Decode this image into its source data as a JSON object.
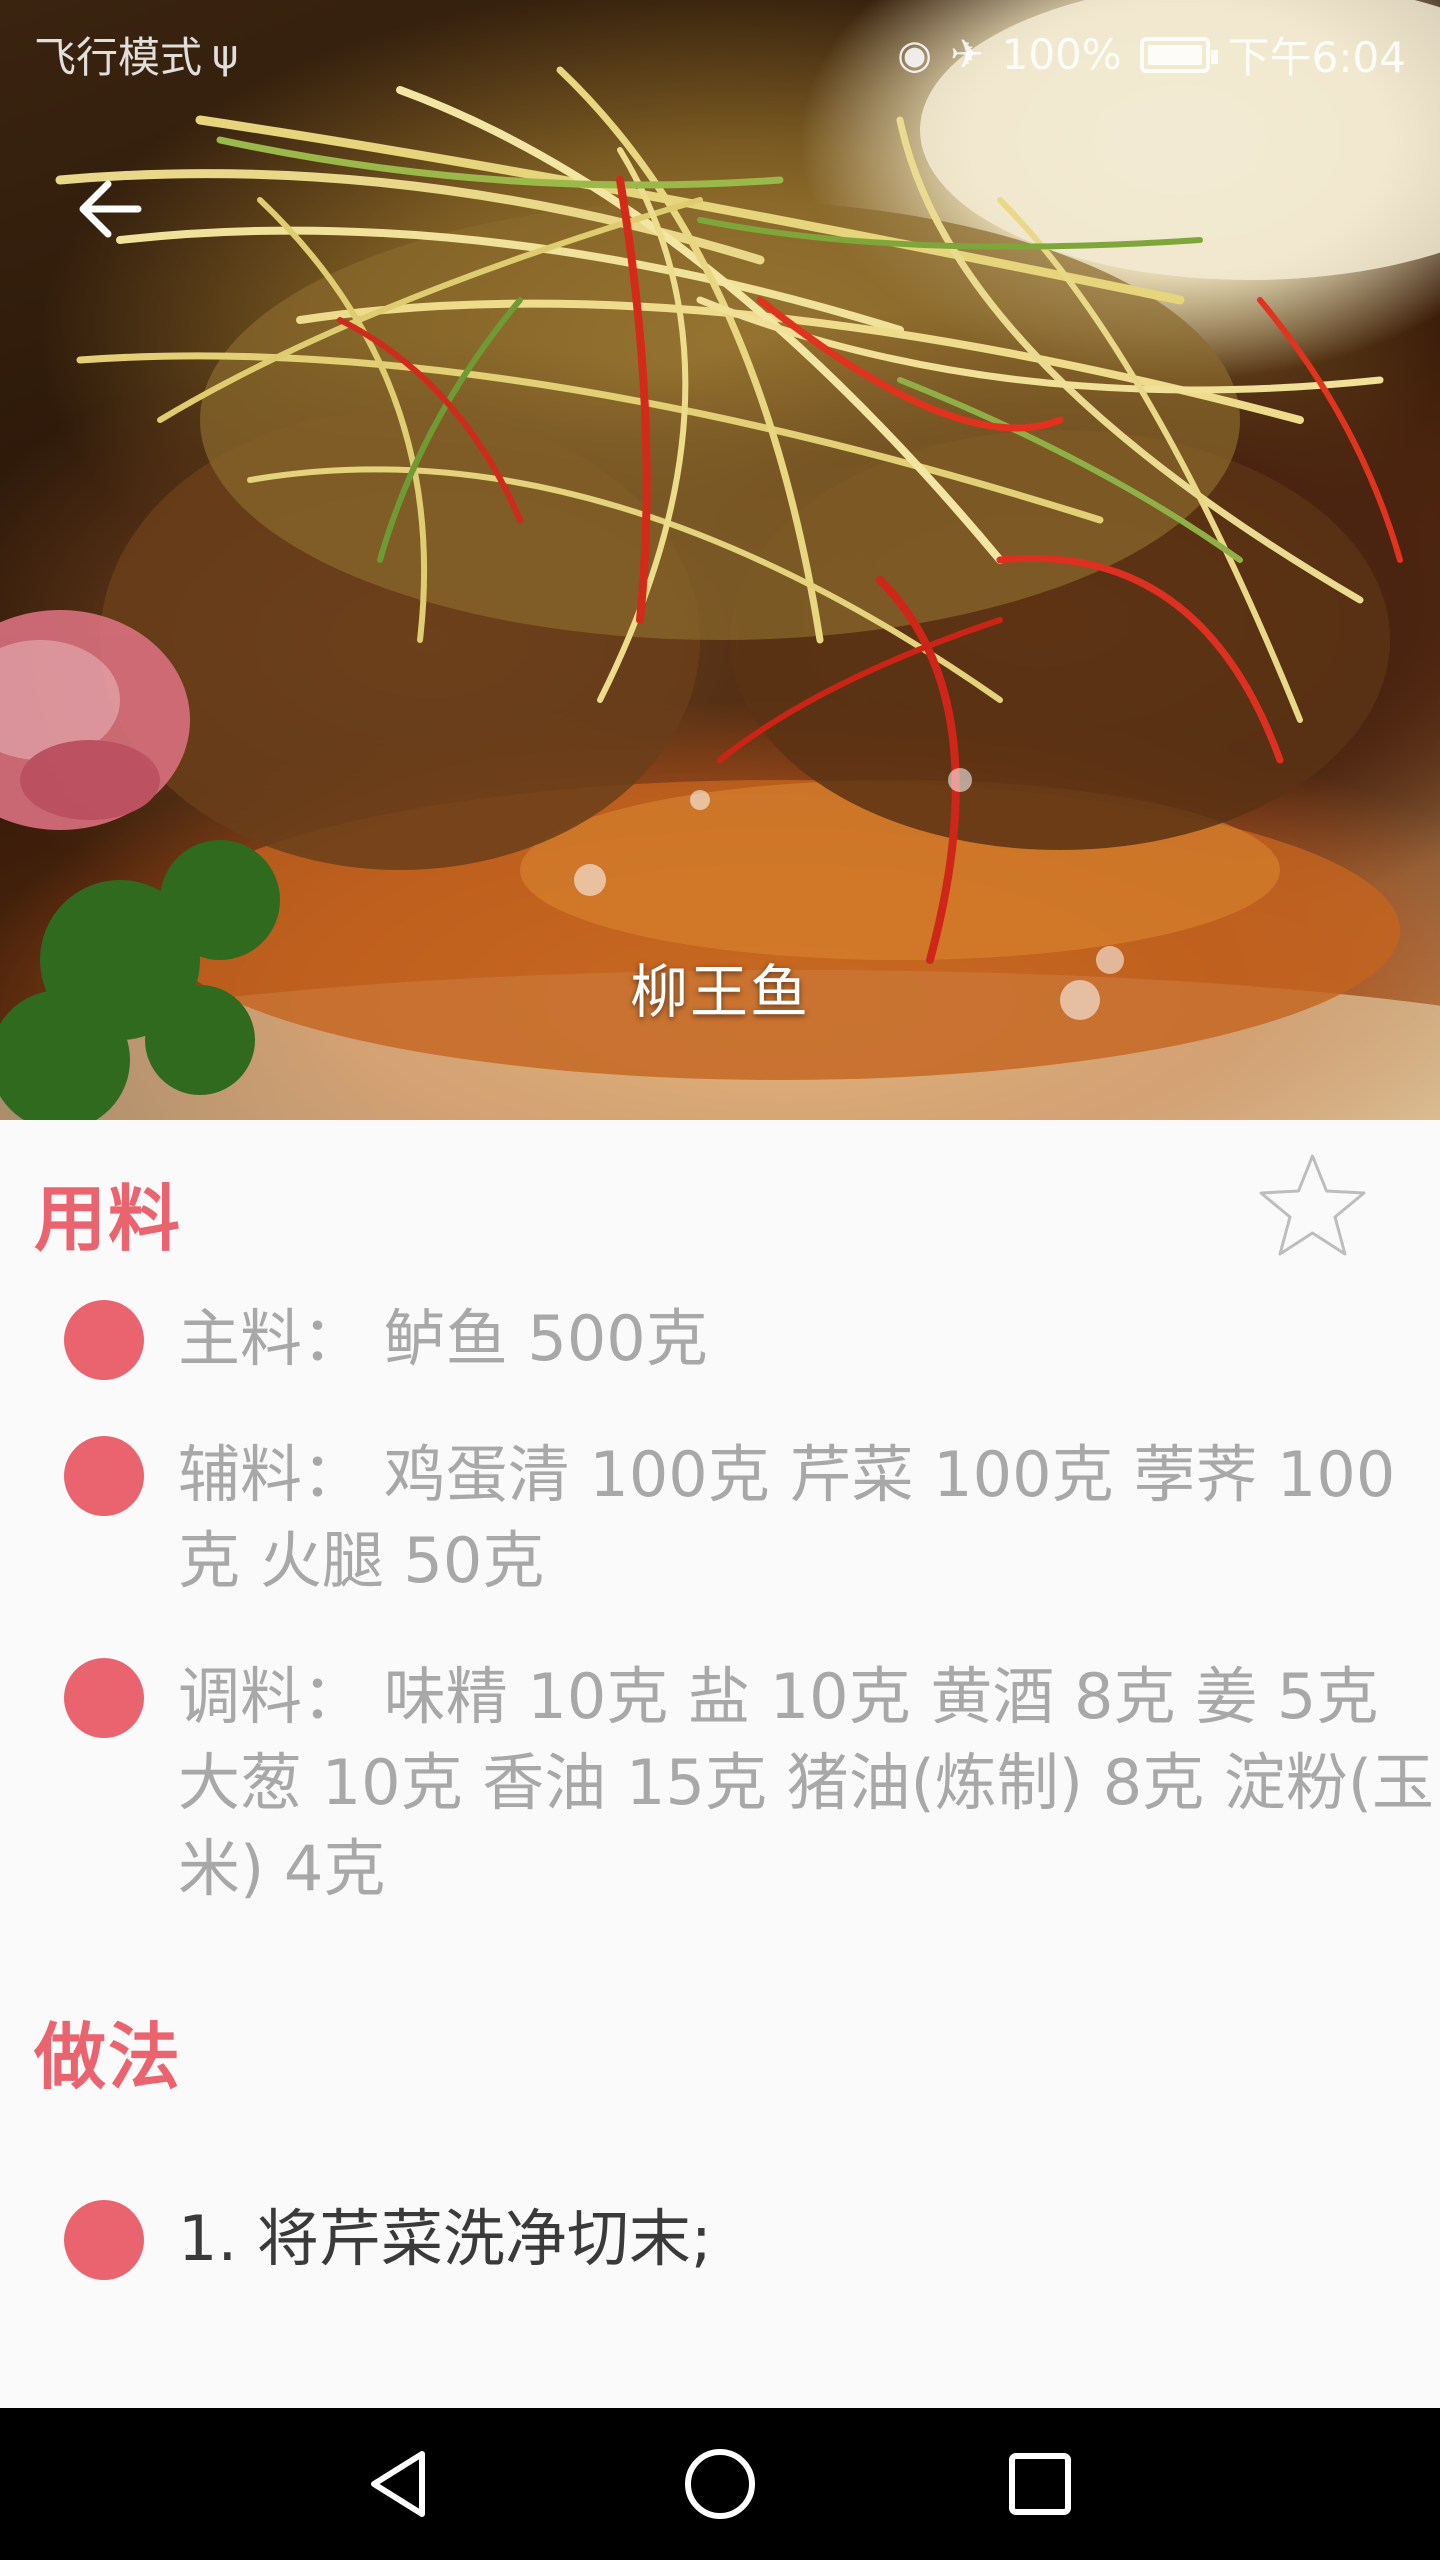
{
  "status_bar": {
    "left_text": "飞行模式",
    "usb_icon": "usb-icon",
    "right_battery": "100%",
    "time": "下午6:04",
    "icons": [
      "eye-icon",
      "airplane-icon",
      "battery-icon"
    ]
  },
  "hero": {
    "dish_name": "柳王鱼",
    "back_icon": "arrow-left-icon"
  },
  "ingredients": {
    "title": "用料",
    "favorite_icon": "star-outline-icon",
    "items": [
      {
        "text": "主料：  鲈鱼 500克"
      },
      {
        "text": "辅料：  鸡蛋清 100克 芹菜 100克 荸荠 100克 火腿 50克"
      },
      {
        "text": "调料：  味精 10克 盐 10克 黄酒 8克 姜 5克 大葱 10克 香油 15克 猪油(炼制) 8克 淀粉(玉米) 4克"
      }
    ]
  },
  "method": {
    "title": "做法",
    "steps": [
      {
        "text": "1. 将芹菜洗净切末;"
      }
    ]
  },
  "nav_bar": {
    "icons": [
      "back-triangle-icon",
      "home-circle-icon",
      "recents-square-icon"
    ]
  },
  "colors": {
    "accent": "#ea6470",
    "muted_text": "#a8a8a8",
    "body_text": "#3a3a3a",
    "background": "#fafafa"
  }
}
